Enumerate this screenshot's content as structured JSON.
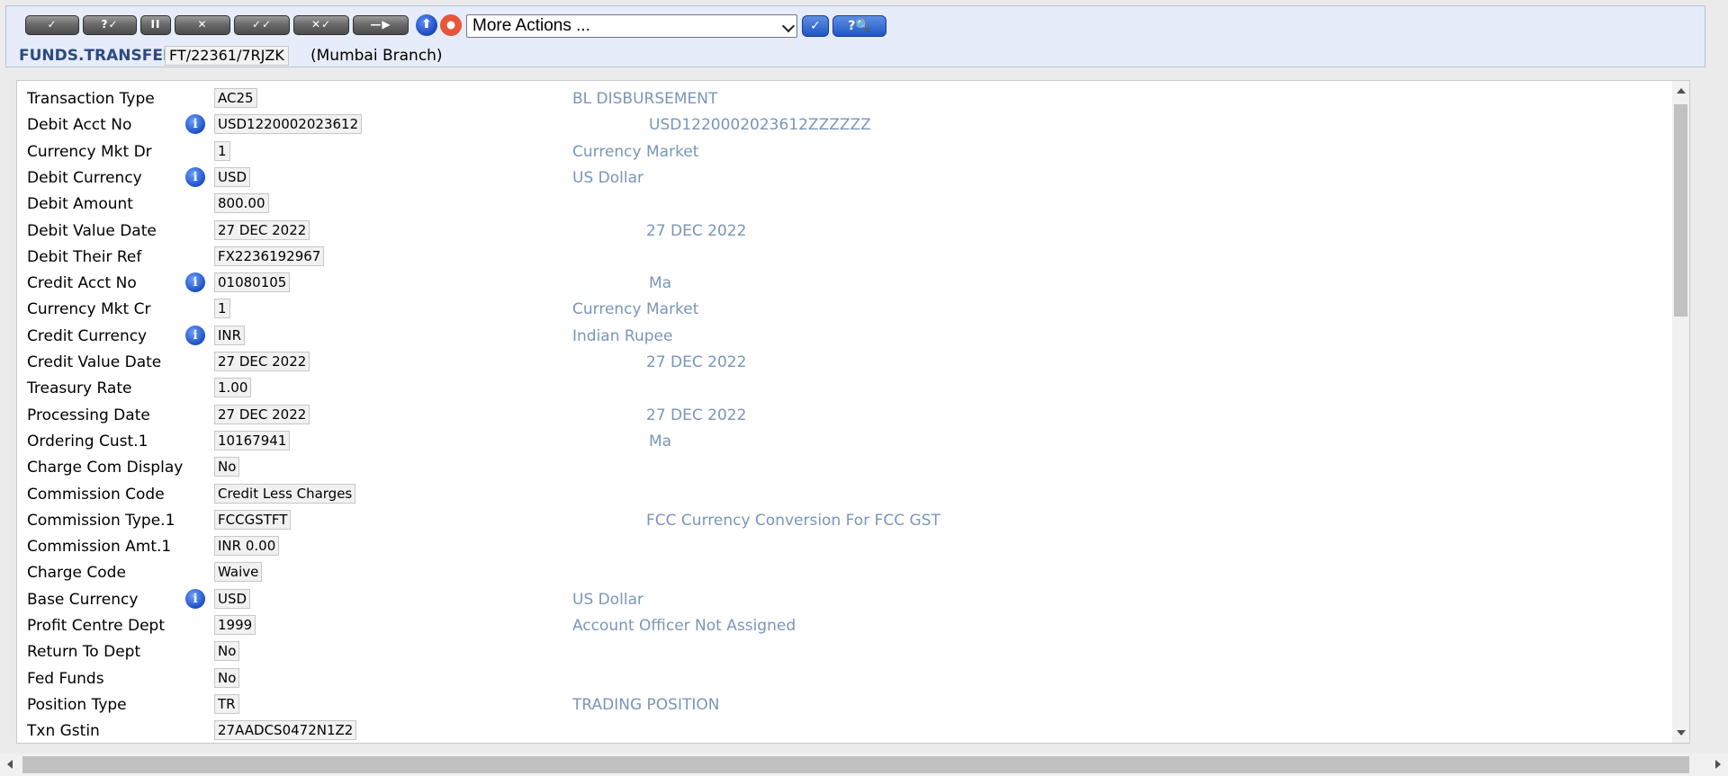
{
  "toolbar": {
    "commit_label": "✓",
    "validate_label": "?✓",
    "hold_label": "II",
    "delete_label": "✕",
    "authorise_label": "✓✓",
    "reverse_label": "✕✓",
    "next_label": "—▶",
    "up_label": "⬆",
    "help_label": "",
    "more_actions": "More Actions ...",
    "go_label": "✓",
    "find_label": "?🔍"
  },
  "header": {
    "application": "FUNDS.TRANSFER",
    "record_id": "FT/22361/7RJZK",
    "branch": "(Mumbai Branch)"
  },
  "fields": [
    {
      "label": "Transaction Type",
      "value": "AC25",
      "info": false,
      "desc": "BL DISBURSEMENT"
    },
    {
      "label": "Debit Acct No",
      "value": "USD1220002023612",
      "info": true,
      "desc": "USD1220002023612ZZZZZZ"
    },
    {
      "label": "Currency Mkt Dr",
      "value": "1",
      "info": false,
      "desc": "Currency Market"
    },
    {
      "label": "Debit Currency",
      "value": "USD",
      "info": true,
      "desc": "US Dollar"
    },
    {
      "label": "Debit Amount",
      "value": "800.00",
      "info": false,
      "desc": ""
    },
    {
      "label": "Debit Value Date",
      "value": "27 DEC 2022",
      "info": false,
      "desc": "27 DEC 2022"
    },
    {
      "label": "Debit Their Ref",
      "value": "FX2236192967",
      "info": false,
      "desc": ""
    },
    {
      "label": "Credit Acct No",
      "value": "01080105",
      "info": true,
      "desc": "Ma"
    },
    {
      "label": "Currency Mkt Cr",
      "value": "1",
      "info": false,
      "desc": "Currency Market"
    },
    {
      "label": "Credit Currency",
      "value": "INR",
      "info": true,
      "desc": "Indian Rupee"
    },
    {
      "label": "Credit Value Date",
      "value": "27 DEC 2022",
      "info": false,
      "desc": "27 DEC 2022"
    },
    {
      "label": "Treasury Rate",
      "value": "1.00",
      "info": false,
      "desc": ""
    },
    {
      "label": "Processing Date",
      "value": "27 DEC 2022",
      "info": false,
      "desc": "27 DEC 2022"
    },
    {
      "label": "Ordering Cust.1",
      "value": "10167941",
      "info": false,
      "desc": "Ma"
    },
    {
      "label": "Charge Com Display",
      "value": "No",
      "info": false,
      "desc": ""
    },
    {
      "label": "Commission Code",
      "value": "Credit Less Charges",
      "info": false,
      "desc": ""
    },
    {
      "label": "Commission Type.1",
      "value": "FCCGSTFT",
      "info": false,
      "desc": "FCC Currency Conversion For FCC GST"
    },
    {
      "label": "Commission Amt.1",
      "value": "INR 0.00",
      "info": false,
      "desc": ""
    },
    {
      "label": "Charge Code",
      "value": "Waive",
      "info": false,
      "desc": ""
    },
    {
      "label": "Base Currency",
      "value": "USD",
      "info": true,
      "desc": "US Dollar"
    },
    {
      "label": "Profit Centre Dept",
      "value": "1999",
      "info": false,
      "desc": "Account Officer Not Assigned"
    },
    {
      "label": "Return To Dept",
      "value": "No",
      "info": false,
      "desc": ""
    },
    {
      "label": "Fed Funds",
      "value": "No",
      "info": false,
      "desc": ""
    },
    {
      "label": "Position Type",
      "value": "TR",
      "info": false,
      "desc": "TRADING POSITION"
    },
    {
      "label": "Txn Gstin",
      "value": "27AADCS0472N1Z2",
      "info": false,
      "desc": ""
    }
  ],
  "info_glyph": "i"
}
